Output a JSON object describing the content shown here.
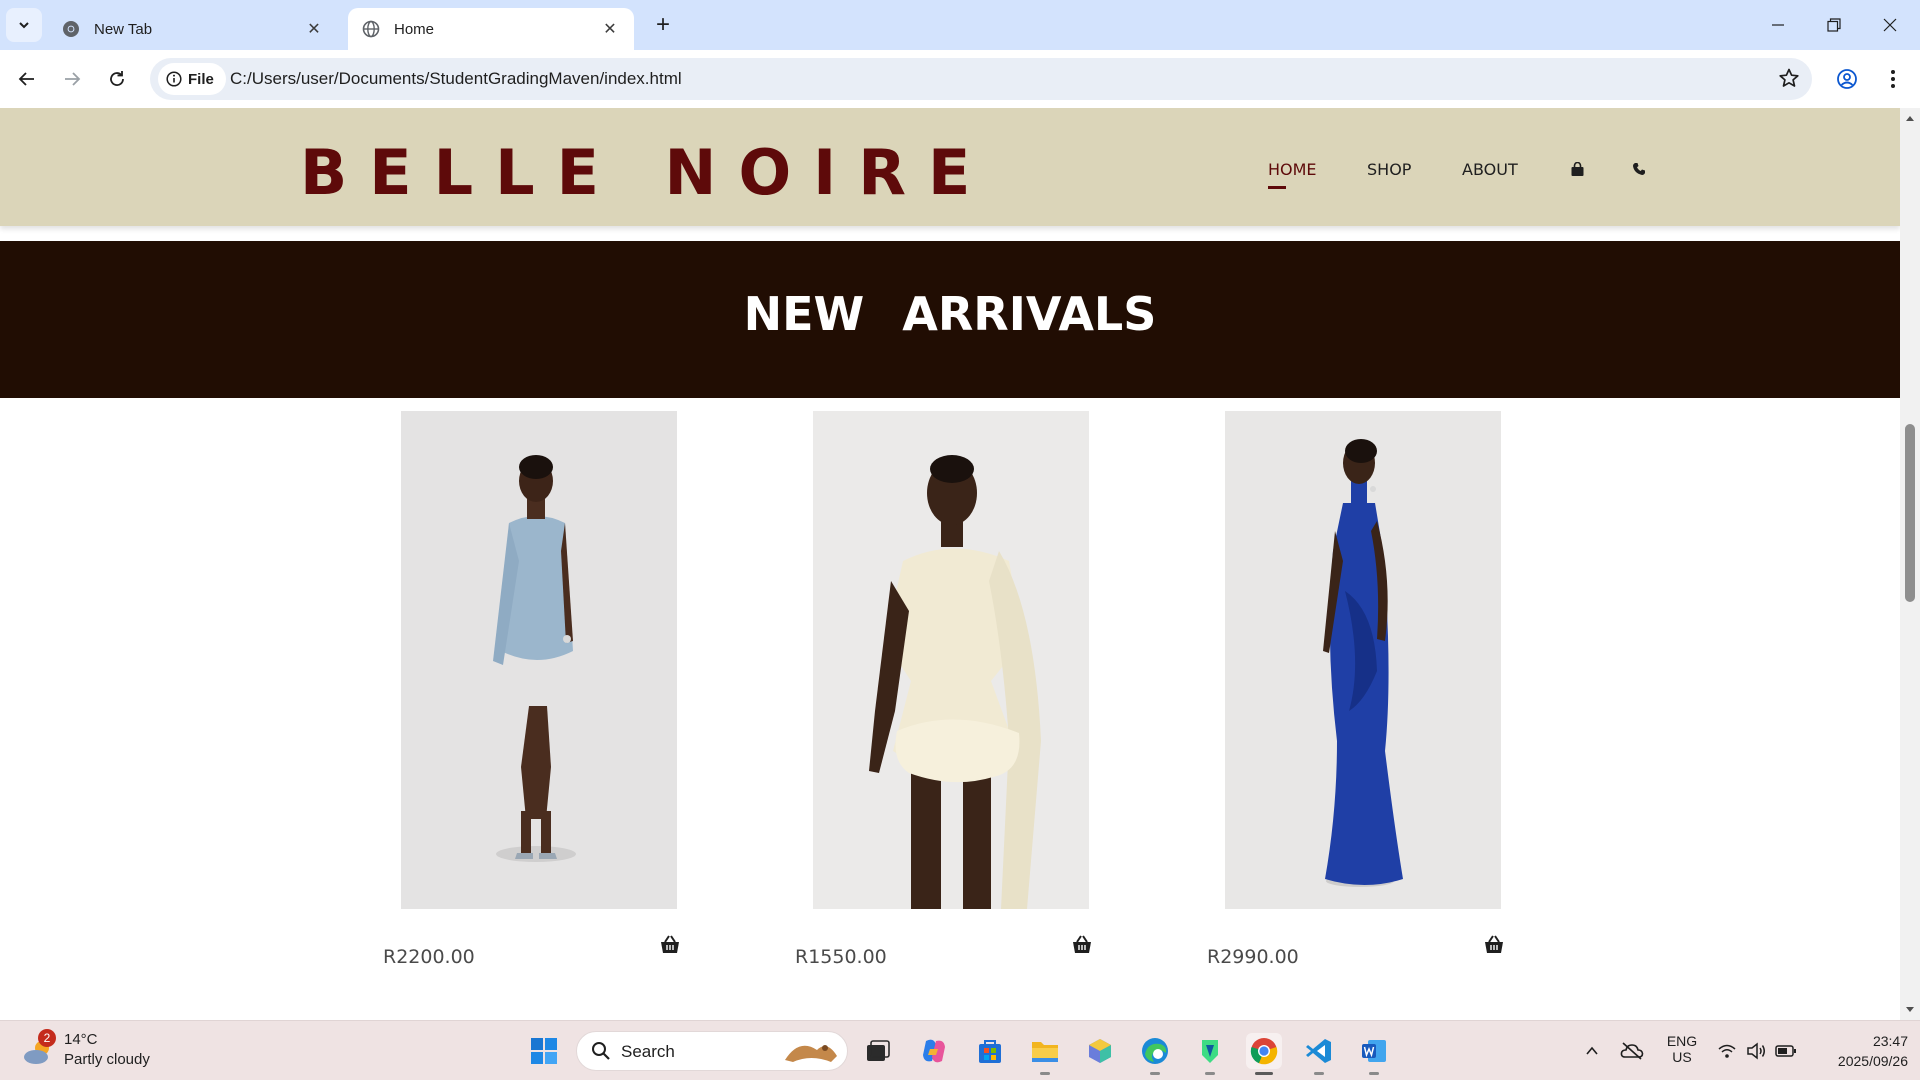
{
  "browser": {
    "tabs": [
      {
        "title": "New Tab",
        "active": false
      },
      {
        "title": "Home",
        "active": true
      }
    ],
    "site_chip": "File",
    "url": "C:/Users/user/Documents/StudentGradingMaven/index.html"
  },
  "site": {
    "logo": "BELLE NOIRE",
    "nav": {
      "home": "HOME",
      "shop": "SHOP",
      "about": "ABOUT",
      "bag_icon": "shopping-bag-icon",
      "phone_icon": "phone-icon"
    },
    "banner_title": "NEW ARRIVALS",
    "products": [
      {
        "price": "R2200.00",
        "dress_color": "#9bb6cc"
      },
      {
        "price": "R1550.00",
        "dress_color": "#f1ead3"
      },
      {
        "price": "R2990.00",
        "dress_color": "#1f3fa6"
      }
    ]
  },
  "colors": {
    "header_bg": "#dbd5b9",
    "logo": "#5e0a0a",
    "banner_bg": "#210d03",
    "tabstrip": "#d3e3fd"
  },
  "taskbar": {
    "weather_temp": "14°C",
    "weather_condition": "Partly cloudy",
    "weather_badge": "2",
    "search_label": "Search",
    "language": "ENG",
    "region": "US",
    "time": "23:47",
    "date": "2025/09/26"
  }
}
